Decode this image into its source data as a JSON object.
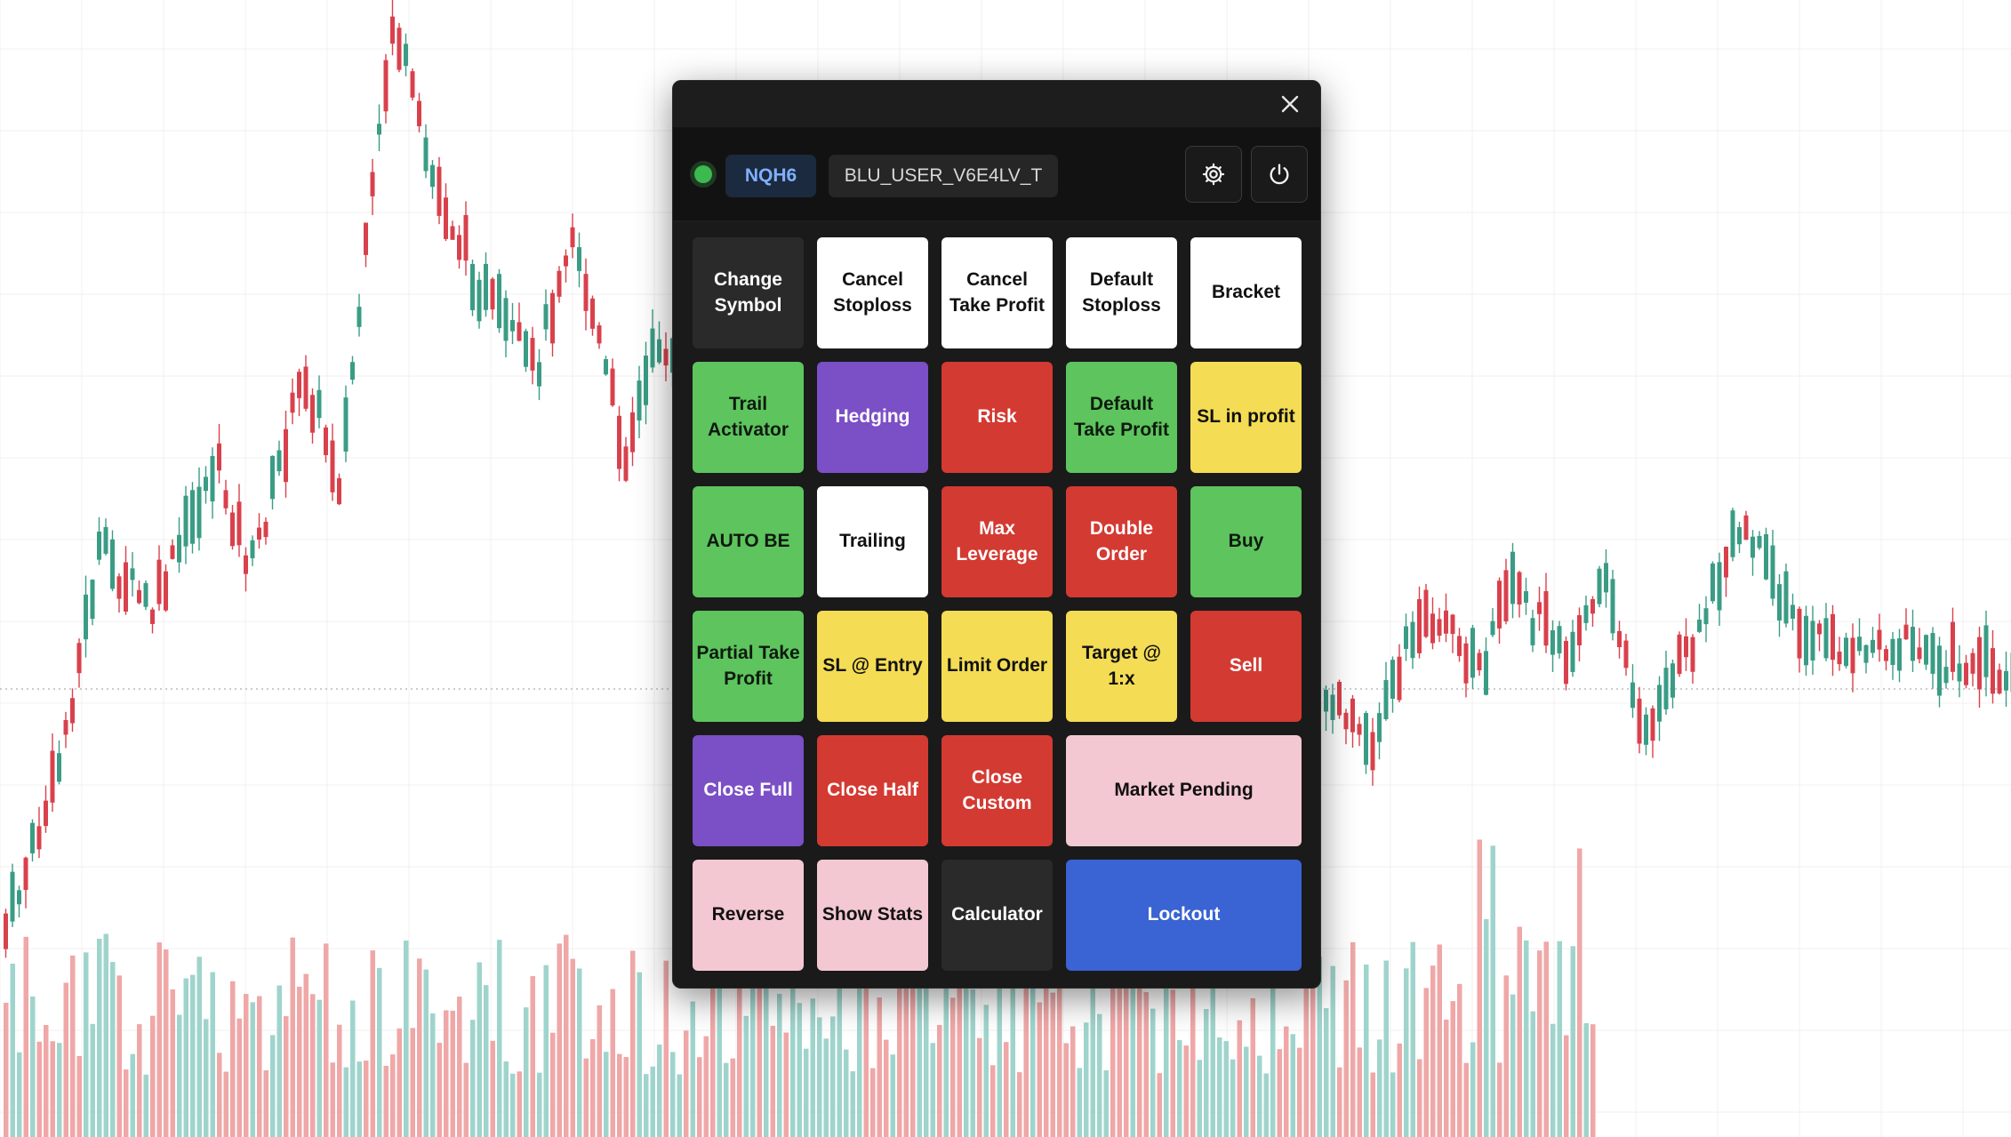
{
  "colors": {
    "panel_bg": "#1a1a1a",
    "status_ok": "#3cb94f",
    "candle_up": "#3a9c85",
    "candle_down": "#d8414c",
    "volume_up": "#9fd4cc",
    "volume_down": "#efa7a7"
  },
  "background_chart": {
    "type": "candlestick",
    "volume_bars": true,
    "grid": true
  },
  "toolbar": {
    "close_icon": "close-icon",
    "settings_icon": "gear-icon",
    "power_icon": "power-icon"
  },
  "status": {
    "connection": "connected",
    "symbol": "NQH6",
    "user": "BLU_USER_V6E4LV_T"
  },
  "buttons": [
    {
      "label": "Change Symbol",
      "name": "change-symbol-button",
      "color": "dark"
    },
    {
      "label": "Cancel Stoploss",
      "name": "cancel-stoploss-button",
      "color": "white"
    },
    {
      "label": "Cancel Take Profit",
      "name": "cancel-take-profit-button",
      "color": "white"
    },
    {
      "label": "Default Stoploss",
      "name": "default-stoploss-button",
      "color": "white"
    },
    {
      "label": "Bracket",
      "name": "bracket-button",
      "color": "white"
    },
    {
      "label": "Trail Activator",
      "name": "trail-activator-button",
      "color": "green"
    },
    {
      "label": "Hedging",
      "name": "hedging-button",
      "color": "purple"
    },
    {
      "label": "Risk",
      "name": "risk-button",
      "color": "red"
    },
    {
      "label": "Default Take Profit",
      "name": "default-take-profit-button",
      "color": "green"
    },
    {
      "label": "SL in profit",
      "name": "sl-in-profit-button",
      "color": "yellow"
    },
    {
      "label": "AUTO BE",
      "name": "auto-be-button",
      "color": "green"
    },
    {
      "label": "Trailing",
      "name": "trailing-button",
      "color": "white"
    },
    {
      "label": "Max Leverage",
      "name": "max-leverage-button",
      "color": "red"
    },
    {
      "label": "Double Order",
      "name": "double-order-button",
      "color": "red"
    },
    {
      "label": "Buy",
      "name": "buy-button",
      "color": "green"
    },
    {
      "label": "Partial Take Profit",
      "name": "partial-take-profit-button",
      "color": "green"
    },
    {
      "label": "SL @ Entry",
      "name": "sl-at-entry-button",
      "color": "yellow"
    },
    {
      "label": "Limit Order",
      "name": "limit-order-button",
      "color": "yellow"
    },
    {
      "label": "Target @ 1:x",
      "name": "target-ratio-button",
      "color": "yellow"
    },
    {
      "label": "Sell",
      "name": "sell-button",
      "color": "red"
    },
    {
      "label": "Close Full",
      "name": "close-full-button",
      "color": "purple"
    },
    {
      "label": "Close Half",
      "name": "close-half-button",
      "color": "red"
    },
    {
      "label": "Close Custom",
      "name": "close-custom-button",
      "color": "red"
    },
    {
      "label": "Market Pending",
      "name": "market-pending-button",
      "color": "pink"
    },
    {
      "label": "Reverse",
      "name": "reverse-button",
      "color": "pink"
    },
    {
      "label": "Show Stats",
      "name": "show-stats-button",
      "color": "pink"
    },
    {
      "label": "Calculator",
      "name": "calculator-button",
      "color": "dark"
    },
    {
      "label": "Lockout",
      "name": "lockout-button",
      "color": "blue"
    }
  ]
}
